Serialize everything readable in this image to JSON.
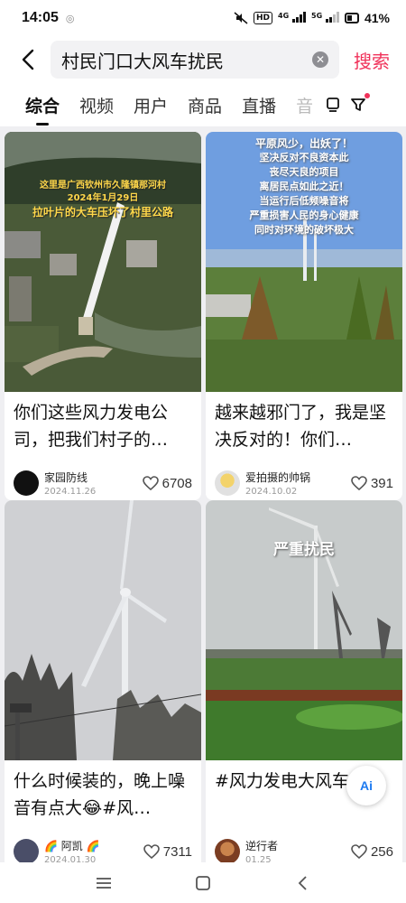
{
  "status_bar": {
    "time": "14:05",
    "hd_badge": "HD",
    "net_4g": "4G",
    "net_5g": "5G",
    "battery": "41%"
  },
  "search": {
    "query": "村民门口大风车扰民",
    "button_label": "搜索"
  },
  "tabs": [
    {
      "label": "综合",
      "active": true
    },
    {
      "label": "视频",
      "active": false
    },
    {
      "label": "用户",
      "active": false
    },
    {
      "label": "商品",
      "active": false
    },
    {
      "label": "直播",
      "active": false
    },
    {
      "label": "音",
      "active": false
    }
  ],
  "results": [
    {
      "overlay_lines": [
        "这里是广西钦州市久隆镇那河村",
        "2024年1月29日",
        "拉叶片的大车压坏了村里公路"
      ],
      "title": "你们这些风力发电公司，把我们村子的…",
      "author": "家园防线",
      "date": "2024.11.26",
      "likes": "6708"
    },
    {
      "overlay_lines": [
        "平原风少，出妖了！",
        "坚决反对不良资本此",
        "丧尽天良的项目",
        "离居民点如此之近！",
        "当运行后低频噪音将",
        "严重损害人民的身心健康",
        "同时对环境的破坏极大"
      ],
      "title": "越来越邪门了，我是坚决反对的！你们…",
      "author": "爱拍摄的帅锅",
      "date": "2024.10.02",
      "likes": "391"
    },
    {
      "title": "什么时候装的，晚上噪音有点大😂#风…",
      "author": "🌈 阿凯 🌈",
      "date": "2024.01.30",
      "likes": "7311"
    },
    {
      "overlay_text": "严重扰民",
      "title": "#风力发电大风车",
      "author": "逆行者",
      "date": "01.25",
      "likes": "256"
    }
  ],
  "ai_button": "Ai",
  "colors": {
    "accent": "#f0325a",
    "background": "#efeff2"
  }
}
